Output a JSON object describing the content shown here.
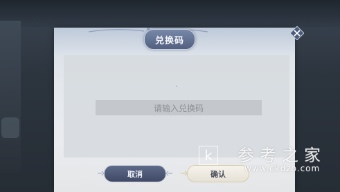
{
  "dialog": {
    "title": "兑换码",
    "input_placeholder": "请输入兑换码",
    "cancel_label": "取消",
    "confirm_label": "确认"
  },
  "watermark": {
    "letter": "k",
    "name": "参考之家",
    "url": "www.ckdzo.com"
  },
  "colors": {
    "title_plate": "#5f6d8e",
    "cancel_button": "#4b5573",
    "confirm_button": "#f0ede6",
    "input_bg": "#c4c7cb"
  }
}
